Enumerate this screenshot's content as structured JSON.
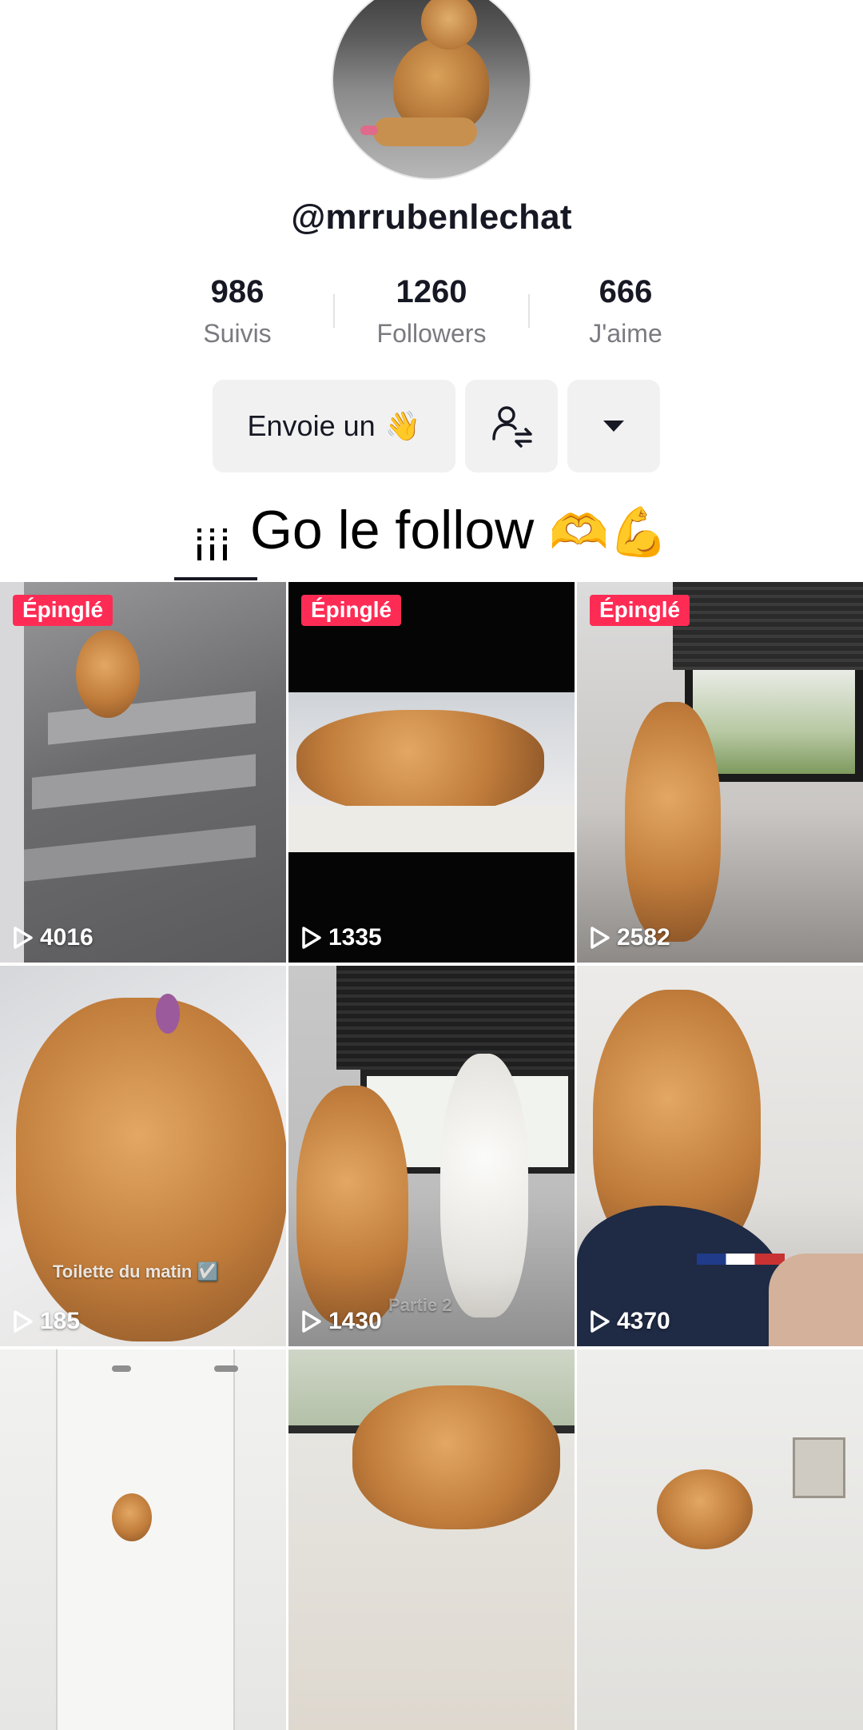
{
  "profile": {
    "username": "@mrrubenlechat",
    "stats": [
      {
        "value": "986",
        "label": "Suivis"
      },
      {
        "value": "1260",
        "label": "Followers"
      },
      {
        "value": "666",
        "label": "J'aime"
      }
    ]
  },
  "actions": {
    "message_label": "Envoie un",
    "message_emoji": "👋",
    "suggest_icon": "person-swap-icon",
    "more_icon": "caret-down-icon"
  },
  "playlist": {
    "icon": "grid-bars-icon",
    "title": "Go le follow",
    "emoji": "🫶💪"
  },
  "pinned_label": "Épinglé",
  "videos": [
    {
      "views": "4016",
      "pinned": true
    },
    {
      "views": "1335",
      "pinned": true
    },
    {
      "views": "2582",
      "pinned": true
    },
    {
      "views": "185",
      "pinned": false,
      "caption": "Toilette du matin ☑️"
    },
    {
      "views": "1430",
      "pinned": false,
      "caption": "Partie 2"
    },
    {
      "views": "4370",
      "pinned": false
    },
    {
      "views": "",
      "pinned": false
    },
    {
      "views": "",
      "pinned": false
    },
    {
      "views": "",
      "pinned": false
    }
  ],
  "colors": {
    "accent": "#fe2c55",
    "text": "#161823",
    "muted": "#7a7a80",
    "button_bg": "#f1f1f2"
  }
}
